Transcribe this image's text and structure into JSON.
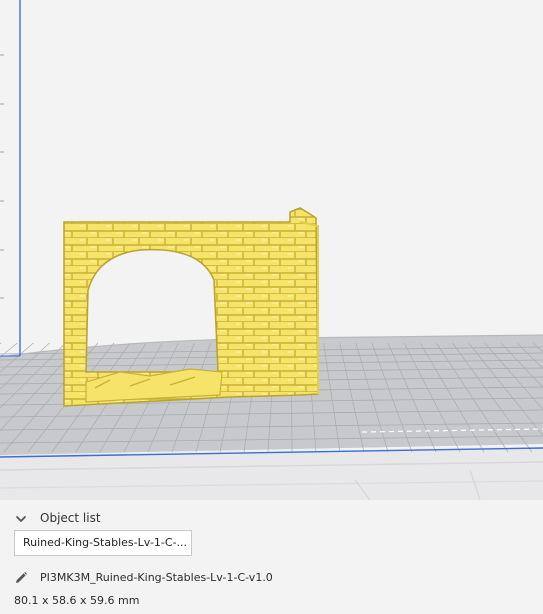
{
  "object_list": {
    "header_label": "Object list",
    "selected_object": "Ruined-King-Stables-Lv-1-C-..."
  },
  "model": {
    "file_name": "PI3MK3M_Ruined-King-Stables-Lv-1-C-v1.0",
    "dimensions": "80.1 x 58.6 x 59.6 mm"
  },
  "icons": {
    "toggle": "chevron-down-icon",
    "edit": "pencil-icon"
  },
  "colors": {
    "background": "#f3f3f4",
    "build_plate": "#c7c9cc",
    "grid_lines": "#a9abae",
    "model_fill": "#f6e46a",
    "model_shadow": "#c8b235",
    "axis_blue": "#3b6fd8"
  }
}
